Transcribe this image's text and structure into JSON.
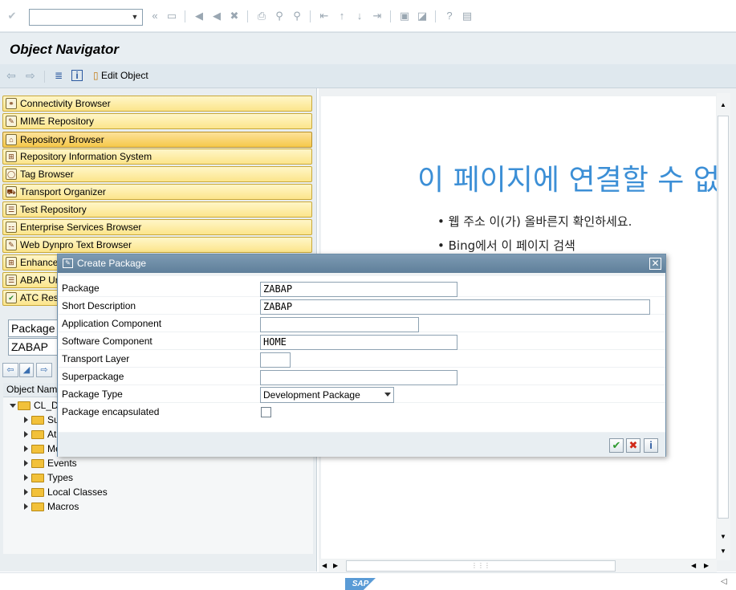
{
  "toolbar": {
    "command_value": "",
    "icons": [
      "enter-icon",
      "dropdown-icon",
      "back-icon",
      "save-icon",
      "exit-icon",
      "cancel-icon",
      "print-icon",
      "find-icon",
      "find-next-icon",
      "first-page-icon",
      "prev-page-icon",
      "next-page-icon",
      "last-page-icon",
      "new-session-icon",
      "shortcut-icon",
      "help-icon",
      "layout-icon"
    ]
  },
  "title": "Object Navigator",
  "app_toolbar": {
    "edit_object_label": "Edit Object"
  },
  "nav_buttons": [
    {
      "label": "Connectivity Browser",
      "icon": "connectivity-icon"
    },
    {
      "label": "MIME Repository",
      "icon": "mime-icon"
    },
    {
      "label": "Repository Browser",
      "icon": "repository-icon",
      "active": true
    },
    {
      "label": "Repository Information System",
      "icon": "info-system-icon"
    },
    {
      "label": "Tag Browser",
      "icon": "tag-icon"
    },
    {
      "label": "Transport Organizer",
      "icon": "transport-icon"
    },
    {
      "label": "Test Repository",
      "icon": "test-icon"
    },
    {
      "label": "Enterprise Services Browser",
      "icon": "services-icon"
    },
    {
      "label": "Web Dynpro Text Browser",
      "icon": "webdynpro-icon"
    },
    {
      "label": "Enhance",
      "icon": "enhancement-icon"
    },
    {
      "label": "ABAP Ur",
      "icon": "abap-icon"
    },
    {
      "label": "ATC Res",
      "icon": "atc-icon"
    }
  ],
  "object_selector": {
    "type_value": "Package",
    "name_value": "ZABAP"
  },
  "tree": {
    "header": "Object Nam",
    "root": "CL_D",
    "children": [
      "Su",
      "At",
      "Me",
      "Events",
      "Types",
      "Local Classes",
      "Macros"
    ]
  },
  "webview": {
    "title": "이 페이지에 연결할 수 없",
    "bullets": [
      "웹 주소 이(가) 올바른지 확인하세요.",
      "Bing에서 이 페이지 검색"
    ]
  },
  "dialog": {
    "title": "Create Package",
    "fields": [
      {
        "label": "Package",
        "value": "ZABAP"
      },
      {
        "label": "Short Description",
        "value": "ZABAP"
      },
      {
        "label": "Application Component",
        "value": ""
      },
      {
        "label": "Software Component",
        "value": "HOME"
      },
      {
        "label": "Transport Layer",
        "value": ""
      },
      {
        "label": "Superpackage",
        "value": ""
      },
      {
        "label": "Package Type",
        "value": "Development Package"
      },
      {
        "label": "Package encapsulated",
        "value": ""
      }
    ]
  },
  "status": {
    "logo": "SAP"
  },
  "colors": {
    "nav_button": "#fce58b",
    "nav_button_active": "#f5c84a",
    "dialog_header": "#6f8fa8",
    "webview_title": "#3c8fd6"
  }
}
